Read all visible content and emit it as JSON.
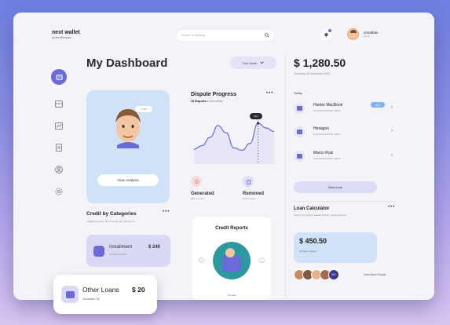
{
  "brand": {
    "name": "next wallet",
    "sub": "by NextDesigns"
  },
  "search": {
    "placeholder": "Search for anything"
  },
  "user": {
    "name": "Jonathan",
    "role": "admin"
  },
  "header": {
    "title": "My Dashboard",
    "period": "This Week"
  },
  "analysis": {
    "badge": "✓ 97",
    "button": "View Analysis"
  },
  "dispute": {
    "title": "Dispute Progress",
    "count": "28 Disputes",
    "count_suffix": "in this month",
    "tooltip": "Dec",
    "generated_label": "Generated",
    "generated_sub": "89k Invested",
    "removed_label": "Removed",
    "removed_sub": "10 Accounts"
  },
  "dispute_chart": {
    "type": "line",
    "x": [
      0,
      1,
      2,
      3,
      4,
      5,
      6,
      7,
      8,
      9,
      10
    ],
    "y": [
      20,
      26,
      40,
      60,
      48,
      22,
      18,
      30,
      64,
      56,
      50
    ],
    "highlight_index": 8
  },
  "categories": {
    "title": "Credit by Categories",
    "subtitle": "Installment loans, line of credit and other items",
    "item": {
      "name": "Installment",
      "sub": "Jonathan William",
      "amount": "$ 240"
    }
  },
  "credit_reports": {
    "title": "Credit Reports",
    "footer": "You are"
  },
  "balance": {
    "amount": "$ 1,280.50",
    "date": "Thursday, 30 December 2020"
  },
  "today": {
    "label": "Today",
    "transactions": [
      {
        "name": "Hunter MacBook",
        "id": "5234A3822489524 48051",
        "tag": "New"
      },
      {
        "name": "Hexagon",
        "id": "5234A3822489524 48051",
        "tag": ""
      },
      {
        "name": "Marco Ruiz",
        "id": "5234A3822489524 48051",
        "tag": ""
      }
    ],
    "view_more": "View more"
  },
  "loan": {
    "title": "Loan Calculator",
    "subtitle": "Select the amount needed and the reimbursement",
    "amount": "$ 450.50",
    "amount_sub": "All Cash Amount",
    "people_more": "20+",
    "view_people": "View More People"
  },
  "other_loans": {
    "name": "Other Loans",
    "amount": "$ 20",
    "sub": "Jonathan W."
  },
  "colors": {
    "accent": "#6a6bd6",
    "panel": "#f4f4f8",
    "card_blue": "#cfe2f7",
    "card_lilac": "#d9d9f5"
  }
}
